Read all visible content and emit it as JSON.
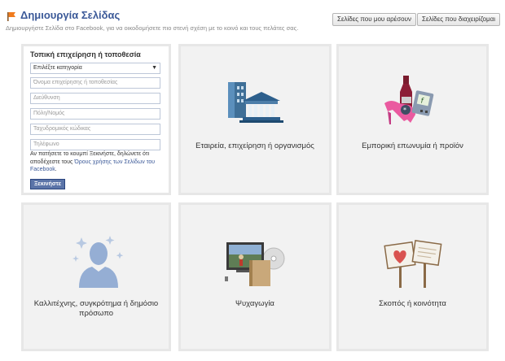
{
  "header": {
    "title": "Δημιουργία Σελίδας",
    "subtitle": "Δημιουργήστε Σελίδα στο Facebook, για να οικοδομήσετε πιο στενή σχέση με το κοινό και τους πελάτες σας."
  },
  "top_buttons": {
    "liked_pages": "Σελίδες που μου αρέσουν",
    "managed_pages": "Σελίδες που διαχειρίζομαι"
  },
  "local_business": {
    "title": "Τοπική επιχείρηση ή τοποθεσία",
    "category_select": "Επιλέξτε κατηγορία",
    "placeholders": {
      "name": "Όνομα επιχείρησης ή τοποθεσίας",
      "address": "Διεύθυνση",
      "city": "Πόλη/Νομός",
      "postal": "Ταχυδρομικός κώδικας",
      "phone": "Τηλέφωνο"
    },
    "terms_text": "Αν πατήσετε το κουμπί Ξεκινήστε, δηλώνετε ότι αποδέχεστε τους ",
    "terms_link": "Όρους χρήσης των Σελίδων του Facebook",
    "terms_end": ".",
    "start_button": "Ξεκινήστε"
  },
  "categories": {
    "company": "Εταιρεία, επιχείρηση ή οργανισμός",
    "brand": "Εμπορική επωνυμία ή προϊόν",
    "artist_line1": "Καλλιτέχνης, συγκρότημα ή δημόσιο",
    "artist_line2": "πρόσωπο",
    "entertainment": "Ψυχαγωγία",
    "cause": "Σκοπός ή κοινότητα"
  },
  "icons": {
    "page_flag": "page-flag-icon",
    "company": "buildings-icon",
    "brand": "products-icon",
    "artist": "person-silhouette-icon",
    "entertainment": "tv-book-cd-icon",
    "cause": "signs-heart-icon"
  },
  "colors": {
    "brand_blue": "#3b5998",
    "tile_bg": "#f2f2f2",
    "tile_border": "#e7e7e7"
  }
}
